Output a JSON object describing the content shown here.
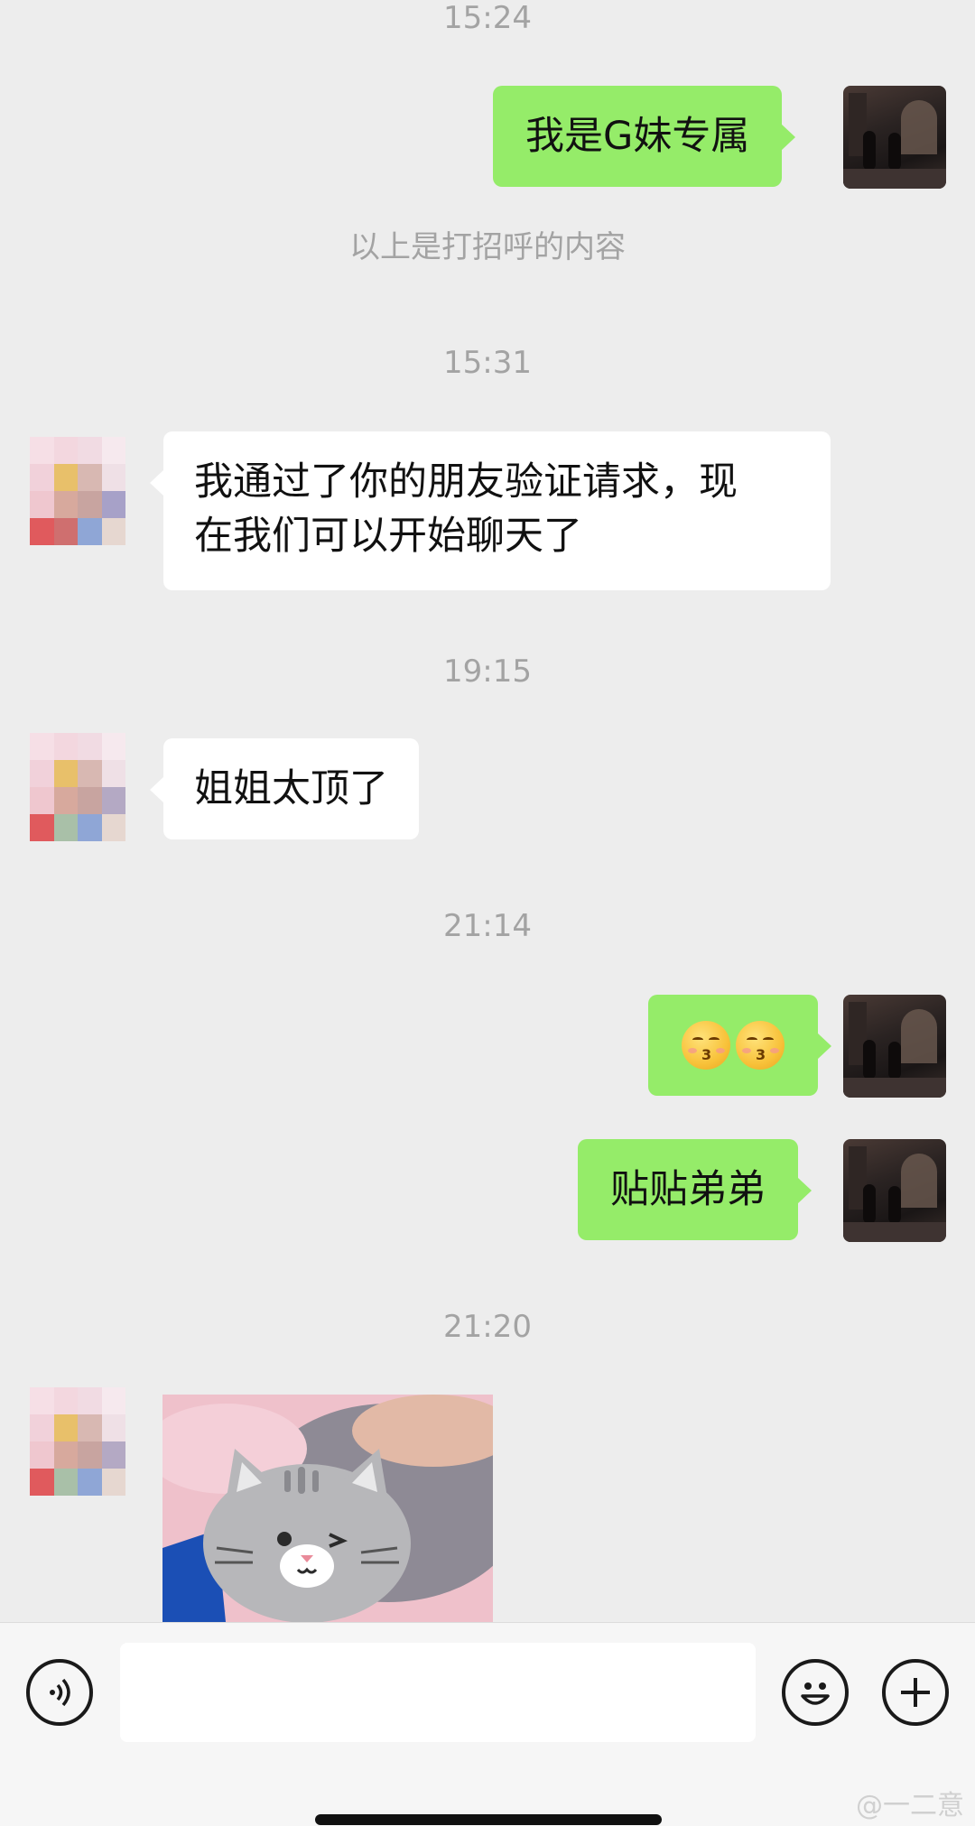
{
  "timestamps": [
    "15:24",
    "15:31",
    "19:15",
    "21:14",
    "21:20"
  ],
  "system_message": "以上是打招呼的内容",
  "messages": {
    "m1": "我是G妹专属",
    "m2_line1": "我通过了你的朋友验证请求，现",
    "m2_line2": "在我们可以开始聊天了",
    "m3": "姐姐太顶了",
    "m5": "贴贴弟弟"
  },
  "emoji_message": {
    "icons": [
      "kissing-face-icon",
      "kissing-face-icon"
    ]
  },
  "image_message": {
    "sticker": "gray-cat-sticker",
    "photo": "pink-pillow-photo"
  },
  "input_bar": {
    "voice_icon": "voice-icon",
    "emoji_icon": "smiley-icon",
    "plus_icon": "plus-icon",
    "value": ""
  },
  "watermark": "@一二意",
  "colors": {
    "background": "#ededed",
    "outgoing_bubble": "#95ec69",
    "incoming_bubble": "#ffffff",
    "timestamp_text": "#a3a3a3"
  }
}
